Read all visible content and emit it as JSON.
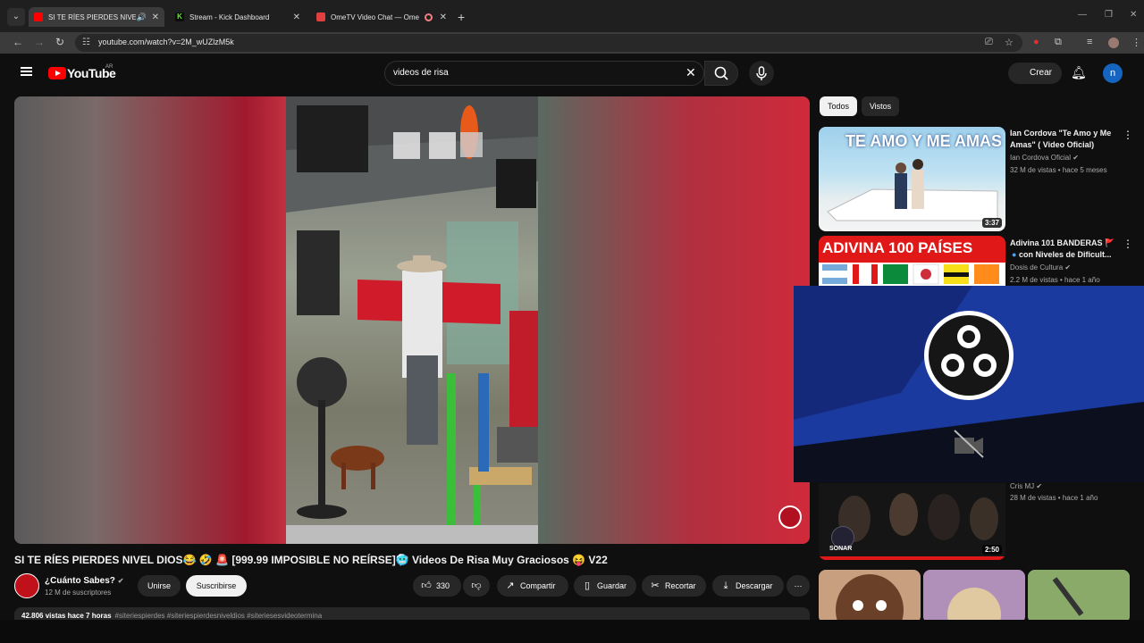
{
  "browser": {
    "tabs": [
      {
        "title": "SI TE RÍES PIERDES NIVEL D",
        "active": true,
        "audio": true,
        "favicon_color": "#ff0000"
      },
      {
        "title": "Stream - Kick Dashboard",
        "active": false,
        "favicon_letter": "K",
        "favicon_color": "#53fc18"
      },
      {
        "title": "OmeTV Video Chat — Ome",
        "active": false,
        "recording": true,
        "favicon_color": "#e04040"
      }
    ],
    "url": "youtube.com/watch?v=2M_wUZlzM5k"
  },
  "youtube": {
    "logo": "YouTube",
    "region": "AR",
    "search_query": "videos de risa",
    "create_label": "Crear",
    "avatar_letter": "n"
  },
  "video": {
    "title": "SI TE RÍES PIERDES NIVEL DIOS😂 🤣 🚨 [999.99 IMPOSIBLE NO REÍRSE]🥶 Videos De Risa Muy Graciosos 😝 V22",
    "channel": "¿Cuánto Sabes?",
    "subscribers": "12 M de suscriptores",
    "join_label": "Unirse",
    "subscribe_label": "Suscribirse",
    "likes": "330",
    "share_label": "Compartir",
    "save_label": "Guardar",
    "clip_label": "Recortar",
    "download_label": "Descargar",
    "views_time": "42.806 vistas  hace 7 horas",
    "hashtags": "#siteriespierdes #siteriespierdesniveldios #siteriesesvideotermina"
  },
  "sidebar": {
    "chips": [
      "Todos",
      "Vistos"
    ],
    "recommendations": [
      {
        "title": "Ian Cordova \"Te Amo y Me Amas\" ( Video Oficial)",
        "channel": "Ian Cordova Oficial",
        "meta": "32 M de vistas • hace 5 meses",
        "duration": "3:37",
        "thumb_text": "TE AMO Y ME AMAS"
      },
      {
        "title": "Adivina 101 BANDERAS 🚩",
        "title_line2": "con Niveles de Dificult...",
        "channel": "Dosis de Cultura",
        "meta": "2.2 M de vistas • hace 1 año",
        "thumb_text": "ADIVINA 100 PAÍSES"
      },
      {
        "title": "",
        "channel": "Cris MJ",
        "meta": "28 M de vistas • hace 1 año",
        "duration": "2:50",
        "thumb_text": "SONAR"
      }
    ]
  },
  "colors": {
    "accent": "#ff0000",
    "background": "#0f0f0f",
    "obs_blue": "#1a3aa0"
  }
}
